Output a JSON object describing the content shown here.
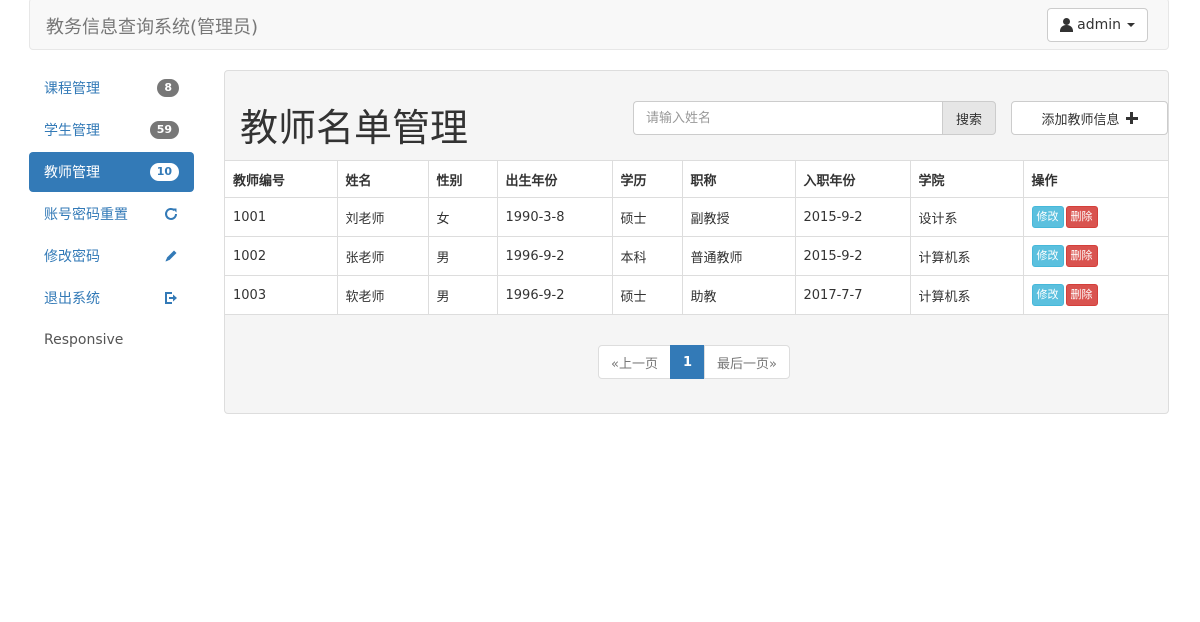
{
  "navbar": {
    "brand": "教务信息查询系统(管理员)",
    "user_label": "admin"
  },
  "sidebar": {
    "items": [
      {
        "label": "课程管理",
        "badge": "8",
        "icon": null,
        "active": false
      },
      {
        "label": "学生管理",
        "badge": "59",
        "icon": null,
        "active": false
      },
      {
        "label": "教师管理",
        "badge": "10",
        "icon": null,
        "active": true
      },
      {
        "label": "账号密码重置",
        "badge": null,
        "icon": "refresh-icon",
        "active": false
      },
      {
        "label": "修改密码",
        "badge": null,
        "icon": "pencil-icon",
        "active": false
      },
      {
        "label": "退出系统",
        "badge": null,
        "icon": "logout-icon",
        "active": false
      }
    ],
    "footer": "Responsive"
  },
  "main": {
    "title": "教师名单管理",
    "search": {
      "placeholder": "请输入姓名",
      "button": "搜索"
    },
    "add_button": "添加教师信息"
  },
  "table": {
    "headers": [
      "教师编号",
      "姓名",
      "性别",
      "出生年份",
      "学历",
      "职称",
      "入职年份",
      "学院",
      "操作"
    ],
    "rows": [
      [
        "1001",
        "刘老师",
        "女",
        "1990-3-8",
        "硕士",
        "副教授",
        "2015-9-2",
        "设计系"
      ],
      [
        "1002",
        "张老师",
        "男",
        "1996-9-2",
        "本科",
        "普通教师",
        "2015-9-2",
        "计算机系"
      ],
      [
        "1003",
        "软老师",
        "男",
        "1996-9-2",
        "硕士",
        "助教",
        "2017-7-7",
        "计算机系"
      ]
    ],
    "edit_label": "修改",
    "delete_label": "删除"
  },
  "pagination": {
    "prev": "«上一页",
    "current": "1",
    "last": "最后一页»"
  },
  "colors": {
    "primary": "#337ab7",
    "info": "#5bc0de",
    "danger": "#d9534f"
  }
}
